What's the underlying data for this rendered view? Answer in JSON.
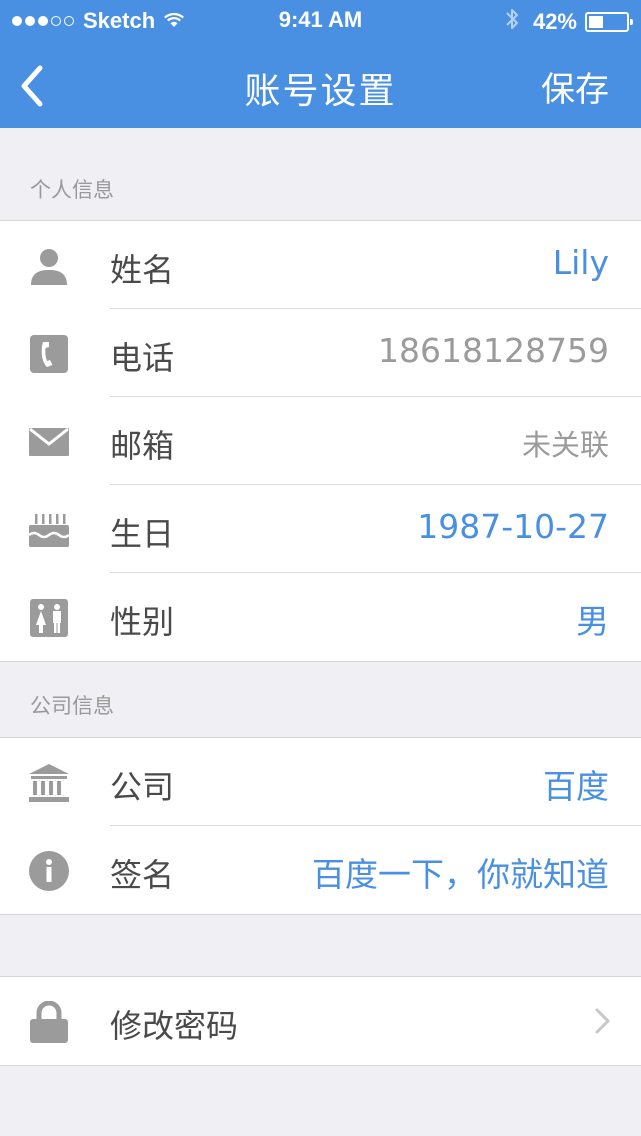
{
  "status_bar": {
    "carrier": "Sketch",
    "time": "9:41 AM",
    "battery": "42%",
    "battery_level": 0.42,
    "signal_strength": 3,
    "signal_max": 5
  },
  "nav": {
    "title": "账号设置",
    "save_label": "保存"
  },
  "sections": {
    "personal": {
      "label": "个人信息",
      "rows": [
        {
          "label": "姓名",
          "value": "Lily",
          "icon": "person-icon"
        },
        {
          "label": "电话",
          "value": "18618128759",
          "icon": "phone-icon"
        },
        {
          "label": "邮箱",
          "value": "未关联",
          "icon": "mail-icon"
        },
        {
          "label": "生日",
          "value": "1987-10-27",
          "icon": "cake-icon"
        },
        {
          "label": "性别",
          "value": "男",
          "icon": "gender-icon"
        }
      ]
    },
    "company": {
      "label": "公司信息",
      "rows": [
        {
          "label": "公司",
          "value": "百度",
          "icon": "bank-icon"
        },
        {
          "label": "签名",
          "value": "百度一下，你就知道",
          "icon": "info-icon"
        }
      ]
    },
    "security": {
      "rows": [
        {
          "label": "修改密码",
          "icon": "lock-icon"
        }
      ]
    }
  },
  "colors": {
    "accent": "#4a90e2",
    "background": "#efeff4",
    "label_text": "#4a4a4a",
    "muted_text": "#9b9b9b",
    "icon": "#9b9b9b"
  }
}
